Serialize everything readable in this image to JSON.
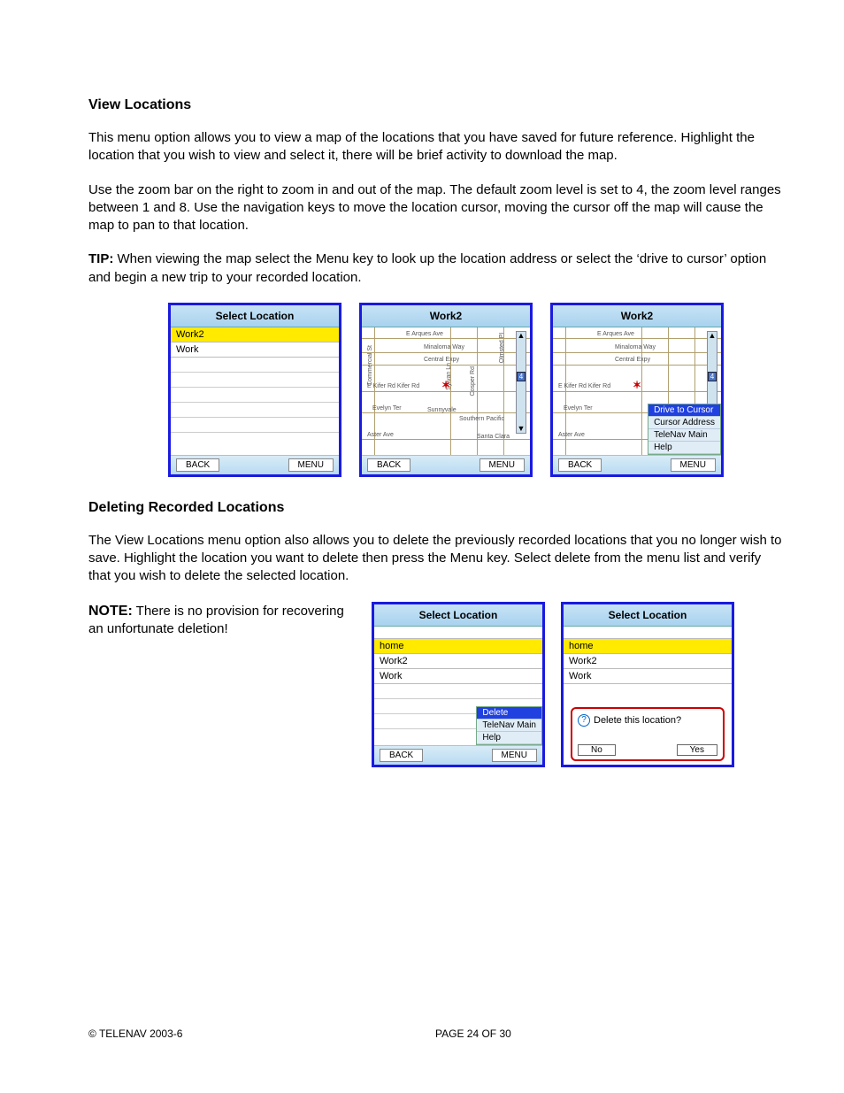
{
  "section1": {
    "heading": "View Locations",
    "p1": "This menu option allows you to view a map of the locations that you have saved for future reference.  Highlight the location that you wish to view and select it, there will be brief activity to download the map.",
    "p2": "Use the zoom bar on the right to zoom in and out of the map.  The default zoom level is set to 4, the zoom level ranges between 1 and 8.  Use the navigation keys to move the location cursor, moving the cursor off the map will cause the map to pan to that location.",
    "tip_label": "TIP:",
    "tip_text": "  When viewing the map select the Menu key to look up the location address or select the ‘drive to cursor’ option and begin a new trip to your recorded location."
  },
  "screens_row1": {
    "s1": {
      "title": "Select Location",
      "items": [
        "Work2",
        "Work"
      ],
      "highlight_index": 0,
      "back": "BACK",
      "menu": "MENU"
    },
    "s2": {
      "title": "Work2",
      "back": "BACK",
      "menu": "MENU",
      "zoom_value": "4",
      "streets_h": [
        "E Arques Ave",
        "Minaloma Way",
        "Central Expy",
        "E Kifer Rd     Kifer Rd",
        "Evelyn Ter",
        "Aster Ave"
      ],
      "streets_v": [
        "Commercial St",
        "Sylvan Ln",
        "Olmsted Pl",
        "Cosper Rd"
      ],
      "extra": [
        "Sunnyvale",
        "Southern Pacific",
        "Santa Clara"
      ]
    },
    "s3": {
      "title": "Work2",
      "back": "BACK",
      "menu": "MENU",
      "zoom_value": "4",
      "popup": [
        "Drive to Cursor",
        "Cursor Address",
        "TeleNav Main",
        "Help"
      ],
      "popup_selected": 0
    }
  },
  "section2": {
    "heading": "Deleting Recorded Locations",
    "p1": "The View Locations menu option also allows you to delete the previously recorded locations that you no longer wish to save.  Highlight the location you want to delete then press the Menu key.  Select delete from the menu list and verify that you wish to delete the selected location.",
    "note_label": "NOTE:",
    "note_text": " There is no provision for recovering an unfortunate deletion!"
  },
  "screens_row2": {
    "s4": {
      "title": "Select Location",
      "items": [
        "home",
        "Work2",
        "Work"
      ],
      "highlight_index": 0,
      "back": "BACK",
      "menu": "MENU",
      "popup": [
        "Delete",
        "TeleNav Main",
        "Help"
      ],
      "popup_selected": 0
    },
    "s5": {
      "title": "Select Location",
      "items": [
        "home",
        "Work2",
        "Work"
      ],
      "highlight_index": 0,
      "dialog_text": "Delete this location?",
      "no": "No",
      "yes": "Yes"
    }
  },
  "footer": {
    "copyright": "© TELENAV 2003-6",
    "page": "PAGE 24 OF 30"
  }
}
